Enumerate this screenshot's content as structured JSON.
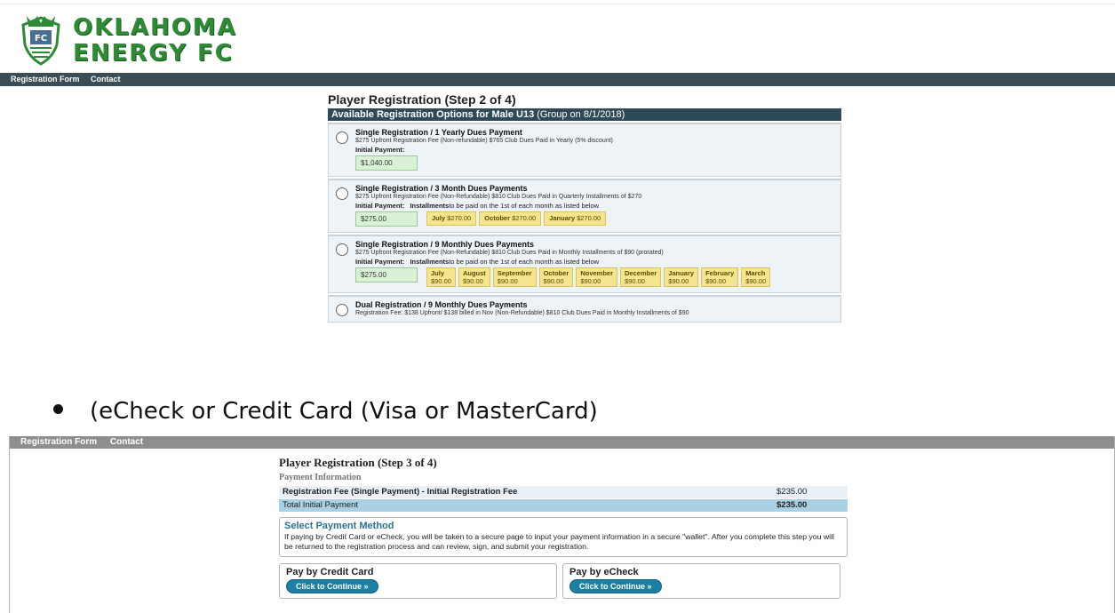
{
  "top": {
    "logo": {
      "line1": "OKLAHOMA",
      "line2": "ENERGY FC",
      "crest_icon": "shield-crest-icon"
    },
    "nav": [
      "Registration Form",
      "Contact"
    ],
    "title": "Player Registration (Step 2 of 4)",
    "subheader": {
      "main": "Available Registration Options for Male U13",
      "group": " (Group on 8/1/2018)"
    },
    "options": [
      {
        "title": "Single Registration / 1 Yearly Dues Payment",
        "desc": "$275 Upfront Registration Fee (Non-refundable) $765 Club Dues Paid in Yearly (5% discount)",
        "initial_label": "Initial Payment:",
        "initial_amount": "$1,040.00"
      },
      {
        "title": "Single Registration / 3 Month Dues Payments",
        "desc": "$275 Upfront Registration Fee (Non-Refundable) $810 Club Dues Paid in Quarterly Installments of $270",
        "initial_label": "Initial Payment:",
        "installments_label": "Installments",
        "installments_rest": " to be paid on the 1st of each month as listed below",
        "initial_amount": "$275.00",
        "installments": [
          {
            "month": "July",
            "amount": "$270.00"
          },
          {
            "month": "October",
            "amount": "$270.00"
          },
          {
            "month": "January",
            "amount": "$270.00"
          }
        ]
      },
      {
        "title": "Single Registration / 9 Monthly Dues Payments",
        "desc": "$275 Upfront Registration Fee (Non-Refundable) $810 Club Dues Paid in Monthly Installments of $90 (prorated)",
        "initial_label": "Initial Payment:",
        "installments_label": "Installments",
        "installments_rest": " to be paid on the 1st of each month as listed below",
        "initial_amount": "$275.00",
        "installments": [
          {
            "month": "July",
            "amount": "$90.00"
          },
          {
            "month": "August",
            "amount": "$90.00"
          },
          {
            "month": "September",
            "amount": "$90.00"
          },
          {
            "month": "October",
            "amount": "$90.00"
          },
          {
            "month": "November",
            "amount": "$90.00"
          },
          {
            "month": "December",
            "amount": "$90.00"
          },
          {
            "month": "January",
            "amount": "$90.00"
          },
          {
            "month": "February",
            "amount": "$90.00"
          },
          {
            "month": "March",
            "amount": "$90.00"
          }
        ]
      },
      {
        "title": "Dual Registration / 9 Monthly Dues Payments",
        "desc": "Registration Fee: $138 Upfront/ $138 billed in Nov (Non-Refundable) $810 Club Dues Paid in Monthly Installments of $90"
      }
    ]
  },
  "bullet": {
    "text": "(eCheck or Credit Card (Visa or MasterCard)"
  },
  "bottom": {
    "nav": [
      "Registration Form",
      "Contact"
    ],
    "title": "Player Registration (Step 3 of 4)",
    "subtitle": "Payment Information",
    "fees": [
      {
        "label": "Registration Fee (Single Payment) - Initial Registration Fee",
        "amount": "$235.00"
      },
      {
        "label": "Total Initial Payment",
        "amount": "$235.00"
      }
    ],
    "method": {
      "title": "Select Payment Method",
      "text": "If paying by Credit Card or eCheck, you will be taken to a secure page to input your payment information in a secure \"wallet\". After you complete this step you will be returned to the registration process and can review, sign, and submit your registration."
    },
    "pay": [
      {
        "title": "Pay by Credit Card",
        "button": "Click to Continue »"
      },
      {
        "title": "Pay by eCheck",
        "button": "Click to Continue »"
      }
    ]
  }
}
